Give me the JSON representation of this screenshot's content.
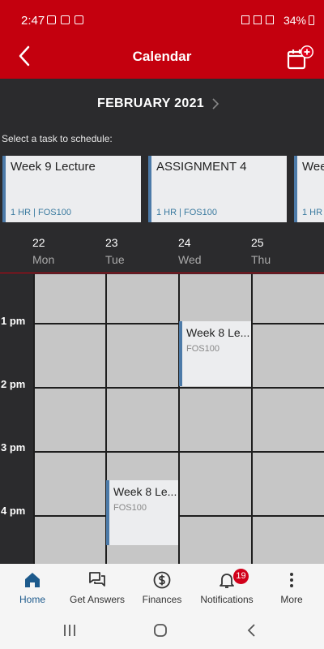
{
  "status_bar": {
    "time": "2:47",
    "battery": "34%"
  },
  "header": {
    "title": "Calendar"
  },
  "month": {
    "label": "FEBRUARY 2021"
  },
  "prompt": "Select a task to schedule:",
  "tasks": [
    {
      "title": "Week 9 Lecture",
      "meta": "1 HR | FOS100"
    },
    {
      "title": "ASSIGNMENT 4",
      "meta": "1 HR | FOS100"
    },
    {
      "title": "Wee",
      "meta": "1 HR"
    }
  ],
  "days": [
    {
      "num": "22",
      "dow": "Mon"
    },
    {
      "num": "23",
      "dow": "Tue"
    },
    {
      "num": "24",
      "dow": "Wed"
    },
    {
      "num": "25",
      "dow": "Thu"
    }
  ],
  "times": [
    "1 pm",
    "2 pm",
    "3 pm",
    "4 pm"
  ],
  "events": [
    {
      "title": "Week 8 Le...",
      "course": "FOS100",
      "day": "Wed",
      "time": "1 pm"
    },
    {
      "title": "Week 8 Le...",
      "course": "FOS100",
      "day": "Tue",
      "time": "4 pm"
    }
  ],
  "nav": [
    {
      "label": "Home",
      "icon": "home-icon"
    },
    {
      "label": "Get Answers",
      "icon": "chat-icon"
    },
    {
      "label": "Finances",
      "icon": "dollar-icon"
    },
    {
      "label": "Notifications",
      "icon": "bell-icon",
      "badge": "19"
    },
    {
      "label": "More",
      "icon": "more-icon"
    }
  ],
  "colors": {
    "brand_red": "#c4000e",
    "dark_bg": "#2b2b2d",
    "accent_blue": "#1d5a8c"
  }
}
